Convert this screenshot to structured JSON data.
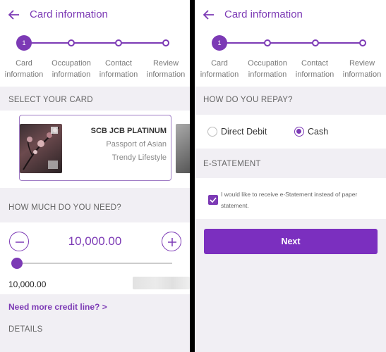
{
  "colors": {
    "accent": "#7c3ab5",
    "button": "#7b2fbf",
    "background": "#f1eff4"
  },
  "left": {
    "header": {
      "title": "Card information",
      "back_icon": "arrow-left-icon"
    },
    "stepper": {
      "active_step": "1",
      "steps": [
        {
          "line1": "Card",
          "line2": "information"
        },
        {
          "line1": "Occupation",
          "line2": "information"
        },
        {
          "line1": "Contact",
          "line2": "information"
        },
        {
          "line1": "Review",
          "line2": "information"
        }
      ]
    },
    "select_card": {
      "label": "SELECT YOUR CARD",
      "card": {
        "name": "SCB JCB PLATINUM",
        "tag1": "Passport of Asian",
        "tag2": "Trendy Lifestyle"
      }
    },
    "amount": {
      "label": "HOW MUCH DO YOU NEED?",
      "value": "10,000.00",
      "input_value": "10,000.00",
      "slider_level": 0,
      "minus_icon": "minus-icon",
      "plus_icon": "plus-icon"
    },
    "more_credit_link": "Need more credit line? >",
    "details_label": "DETAILS"
  },
  "right": {
    "header": {
      "title": "Card information",
      "back_icon": "arrow-left-icon"
    },
    "stepper": {
      "active_step": "1",
      "steps": [
        {
          "line1": "Card",
          "line2": "information"
        },
        {
          "line1": "Occupation",
          "line2": "information"
        },
        {
          "line1": "Contact",
          "line2": "information"
        },
        {
          "line1": "Review",
          "line2": "information"
        }
      ]
    },
    "repay": {
      "label": "HOW DO YOU REPAY?",
      "options": [
        "Direct Debit",
        "Cash"
      ],
      "selected": "Cash"
    },
    "estatement": {
      "label": "E-STATEMENT",
      "checkbox_checked": true,
      "checkbox_label": "I would like to receive e-Statement instead of paper statement."
    },
    "next_button": "Next"
  }
}
